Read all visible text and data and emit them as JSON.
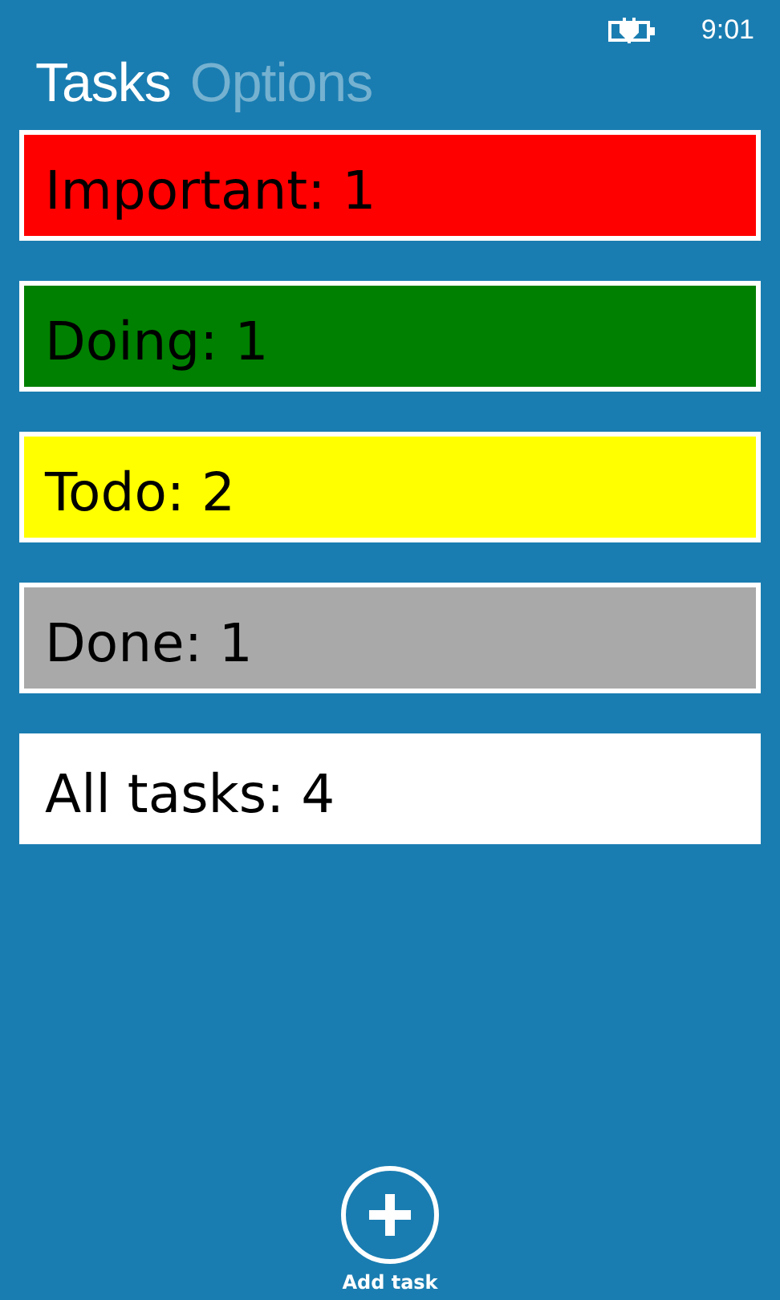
{
  "status_bar": {
    "time": "9:01"
  },
  "pivot": [
    {
      "label": "Tasks",
      "selected": true
    },
    {
      "label": "Options",
      "selected": false
    }
  ],
  "categories": [
    {
      "label": "Important: 1",
      "color": "#ff0000"
    },
    {
      "label": "Doing: 1",
      "color": "#008000"
    },
    {
      "label": "Todo: 2",
      "color": "#ffff00"
    },
    {
      "label": "Done: 1",
      "color": "#a9a9a9"
    },
    {
      "label": "All tasks: 4",
      "color": "#ffffff"
    }
  ],
  "app_bar": {
    "button": {
      "label": "Add task"
    }
  }
}
